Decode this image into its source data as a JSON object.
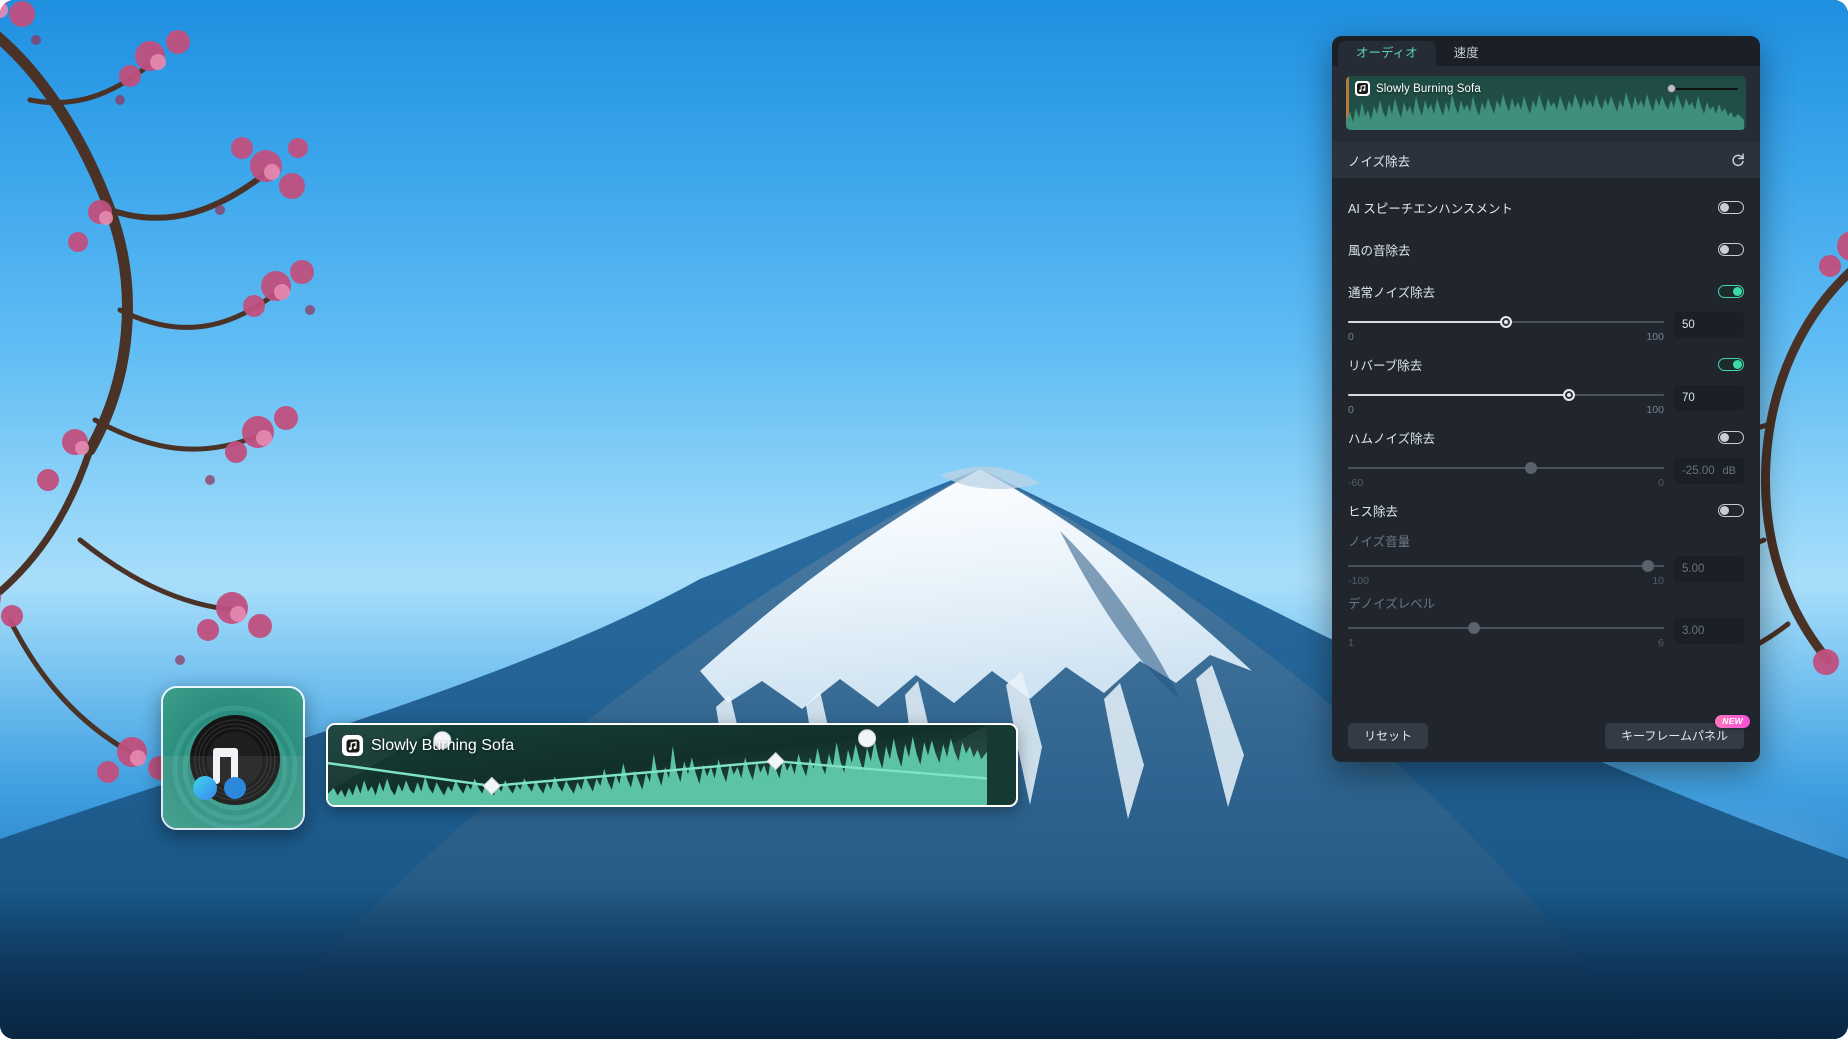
{
  "panel": {
    "tabs": [
      {
        "label": "オーディオ",
        "active": true
      },
      {
        "label": "速度",
        "active": false
      }
    ],
    "clip_preview": {
      "title": "Slowly Burning Sofa",
      "icon": "music-note-icon"
    },
    "section": {
      "title": "ノイズ除去",
      "reset_icon": "reset-arrow-icon"
    },
    "controls": [
      {
        "name": "ai-speech-enhancement",
        "label": "AI スピーチエンハンスメント",
        "toggle": "off"
      },
      {
        "name": "wind-noise-removal",
        "label": "風の音除去",
        "toggle": "off"
      },
      {
        "name": "normal-noise-removal",
        "label": "通常ノイズ除去",
        "toggle": "on",
        "slider": {
          "value": "50",
          "min": "0",
          "max": "100",
          "percent": 50,
          "unit": ""
        }
      },
      {
        "name": "reverb-removal",
        "label": "リバーブ除去",
        "toggle": "on",
        "slider": {
          "value": "70",
          "min": "0",
          "max": "100",
          "percent": 70,
          "unit": ""
        }
      },
      {
        "name": "hum-noise-removal",
        "label": "ハムノイズ除去",
        "toggle": "off",
        "slider": {
          "value": "-25.00",
          "min": "-60",
          "max": "0",
          "percent": 58,
          "unit": "dB"
        }
      },
      {
        "name": "hiss-removal",
        "label": "ヒス除去",
        "toggle": "off",
        "sub_controls": [
          {
            "name": "noise-volume",
            "label": "ノイズ音量",
            "slider": {
              "value": "5.00",
              "min": "-100",
              "max": "10",
              "percent": 95,
              "unit": ""
            }
          },
          {
            "name": "denoise-level",
            "label": "デノイズレベル",
            "slider": {
              "value": "3.00",
              "min": "1",
              "max": "6",
              "percent": 40,
              "unit": ""
            }
          }
        ]
      }
    ],
    "footer": {
      "reset_label": "リセット",
      "keyframe_label": "キーフレームパネル",
      "new_badge": "NEW"
    }
  },
  "timeline": {
    "clip": {
      "title": "Slowly Burning Sofa",
      "icon": "music-note-icon"
    }
  },
  "colors": {
    "accent_green": "#3fd8a8",
    "tab_active_text": "#58d3b4",
    "panel_bg": "#21262e",
    "badge_pink": "#f95fd0",
    "waveform": "#5cc3a5"
  }
}
